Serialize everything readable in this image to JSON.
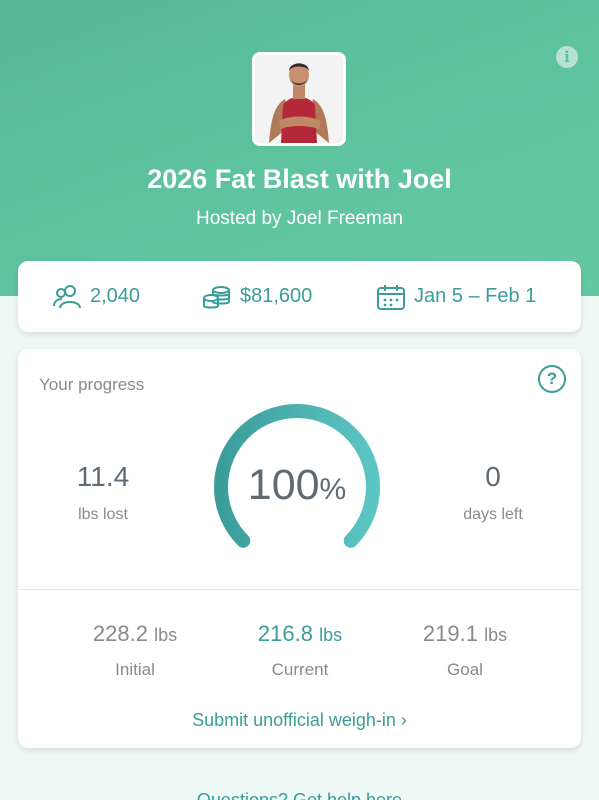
{
  "header": {
    "title": "2026 Fat Blast with Joel",
    "host": "Hosted by Joel Freeman",
    "info_icon": "info-icon"
  },
  "stats": {
    "participants": "2,040",
    "pot": "$81,600",
    "dates": "Jan 5 – Feb 1"
  },
  "progress": {
    "label": "Your progress",
    "percent_value": "100",
    "percent_sign": "%",
    "percent_fraction": 1.0,
    "lbs_lost": "11.4",
    "lbs_lost_label": "lbs lost",
    "days_left": "0",
    "days_left_label": "days left",
    "initial": {
      "value": "228.2",
      "unit": "lbs",
      "label": "Initial"
    },
    "current": {
      "value": "216.8",
      "unit": "lbs",
      "label": "Current"
    },
    "goal": {
      "value": "219.1",
      "unit": "lbs",
      "label": "Goal"
    },
    "weigh_in_link": "Submit unofficial weigh-in"
  },
  "footer": {
    "help_link": "Questions? Get help here"
  },
  "colors": {
    "accent": "#3a9d9a",
    "hero": "#5cbf9d"
  }
}
